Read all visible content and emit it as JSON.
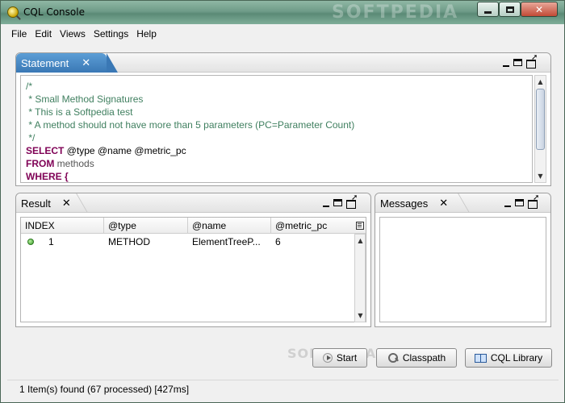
{
  "window": {
    "title": "CQL Console",
    "watermark": "SOFTPEDIA",
    "controls": {
      "minimize": "minimize",
      "maximize": "maximize",
      "close": "✕"
    }
  },
  "menu": [
    "File",
    "Edit",
    "Views",
    "Settings",
    "Help"
  ],
  "statement": {
    "tab_label": "Statement",
    "lines": [
      "/*",
      " * Small Method Signatures",
      " * This is a Softpedia test",
      " * A method should not have more than 5 parameters (PC=Parameter Count)",
      " */",
      "SELECT @type @name @metric_pc",
      "FROM methods",
      "WHERE {"
    ]
  },
  "result": {
    "tab_label": "Result",
    "columns": [
      "INDEX",
      "@type",
      "@name",
      "@metric_pc"
    ],
    "rows": [
      {
        "status": "green",
        "index": "1",
        "type": "METHOD",
        "name": "ElementTreeP...",
        "metric_pc": "6"
      }
    ]
  },
  "messages": {
    "tab_label": "Messages"
  },
  "buttons": {
    "start": "Start",
    "classpath": "Classpath",
    "cql_library": "CQL Library"
  },
  "watermark_bottom": "SOFTPEDIA",
  "status": "1 Item(s) found (67 processed) [427ms]",
  "colors": {
    "keyword": "#7f0055",
    "comment": "#3f7f5f",
    "active_tab": "#3a78b5"
  }
}
